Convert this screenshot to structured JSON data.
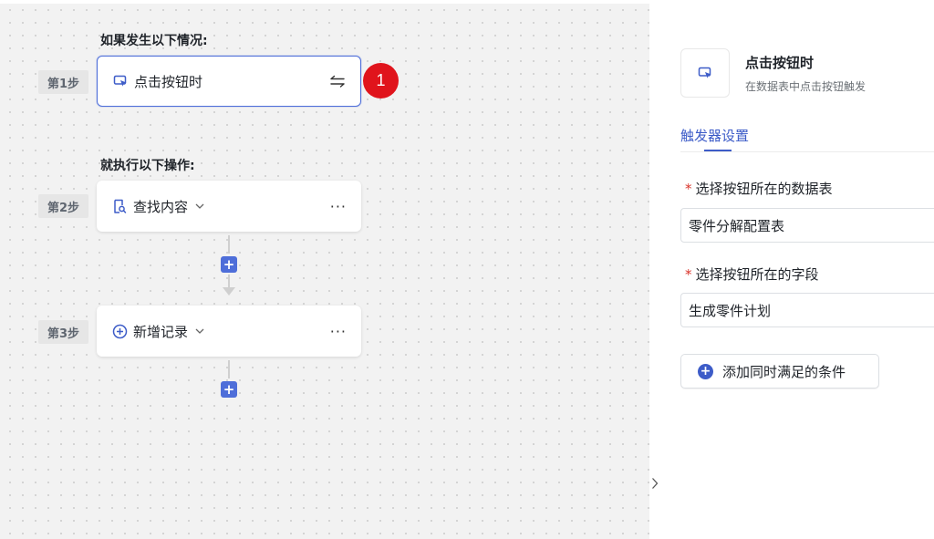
{
  "workflow": {
    "condition_heading": "如果发生以下情况:",
    "action_heading": "就执行以下操作:",
    "steps": [
      {
        "label": "第1步",
        "title": "点击按钮时",
        "icon": "cursor-click-icon"
      },
      {
        "label": "第2步",
        "title": "查找内容",
        "icon": "search-doc-icon"
      },
      {
        "label": "第3步",
        "title": "新增记录",
        "icon": "plus-circle-icon"
      }
    ],
    "more_label": "···",
    "badge": "1"
  },
  "panel": {
    "title": "点击按钮时",
    "subtitle": "在数据表中点击按钮触发",
    "tab": "触发器设置",
    "fields": [
      {
        "label": "选择按钮所在的数据表",
        "required_mark": "*",
        "value": "零件分解配置表"
      },
      {
        "label": "选择按钮所在的字段",
        "required_mark": "*",
        "value": "生成零件计划"
      }
    ],
    "add_condition_label": "添加同时满足的条件"
  },
  "colors": {
    "accent": "#4e6ed9",
    "badge": "#e0141c",
    "required": "#d9342b"
  }
}
